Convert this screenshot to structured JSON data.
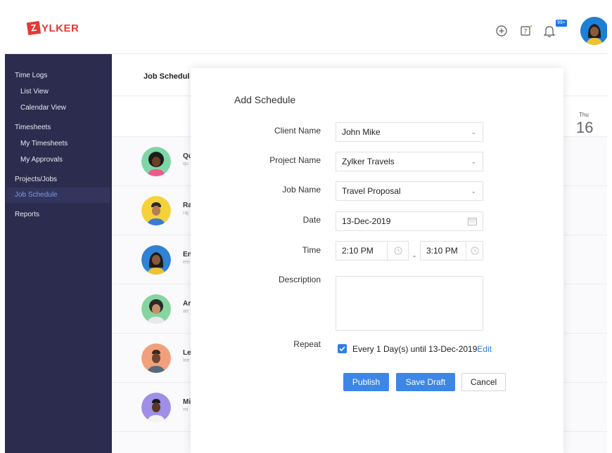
{
  "app": {
    "logo_letter": "Z",
    "logo_text": "YLKER",
    "notification_count": "99+"
  },
  "colors": {
    "sidebar_bg": "#2b2c4e",
    "accent": "#3c87e6",
    "brand": "#e23b35"
  },
  "sidebar": {
    "items": [
      {
        "label": "Time Logs",
        "type": "group"
      },
      {
        "label": "List View",
        "type": "sub"
      },
      {
        "label": "Calendar View",
        "type": "sub"
      },
      {
        "label": "Timesheets",
        "type": "group"
      },
      {
        "label": "My Timesheets",
        "type": "sub"
      },
      {
        "label": "My Approvals",
        "type": "sub"
      },
      {
        "label": "Projects/Jobs",
        "type": "group"
      },
      {
        "label": "Job Schedule",
        "type": "active"
      },
      {
        "label": "Reports",
        "type": "group"
      }
    ]
  },
  "main": {
    "title": "Job Schedul",
    "day_label": "Thu",
    "day_number": "16",
    "people": [
      {
        "name": "Qu",
        "sub": "qu"
      },
      {
        "name": "Ra",
        "sub": "raj"
      },
      {
        "name": "En",
        "sub": "em"
      },
      {
        "name": "Ar",
        "sub": "arr"
      },
      {
        "name": "Le",
        "sub": "lee"
      },
      {
        "name": "Mi",
        "sub": "mi"
      }
    ]
  },
  "modal": {
    "title": "Add Schedule",
    "client_label": "Client Name",
    "client_value": "John Mike",
    "project_label": "Project Name",
    "project_value": "Zylker Travels",
    "job_label": "Job Name",
    "job_value": "Travel Proposal",
    "date_label": "Date",
    "date_value": "13-Dec-2019",
    "time_label": "Time",
    "time_start": "2:10 PM",
    "time_separator": "-",
    "time_end": "3:10 PM",
    "description_label": "Description",
    "description_value": "",
    "repeat_label": "Repeat",
    "repeat_text": "Every 1 Day(s) until 13-Dec-2019",
    "repeat_edit": "Edit",
    "publish_label": "Publish",
    "save_draft_label": "Save Draft",
    "cancel_label": "Cancel"
  }
}
